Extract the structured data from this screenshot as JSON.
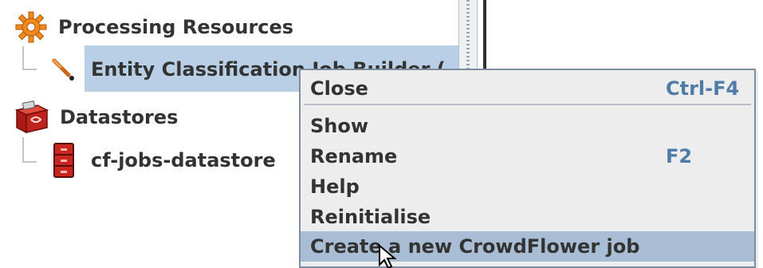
{
  "tree": {
    "processing_resources": {
      "label": "Processing Resources",
      "icon": "gear-icon"
    },
    "entity_classification": {
      "label": "Entity Classification Job Builder (",
      "icon": "wrench-icon"
    },
    "datastores": {
      "label": "Datastores",
      "icon": "datastore-box-icon"
    },
    "cf_jobs_datastore": {
      "label": "cf-jobs-datastore",
      "icon": "file-cabinet-icon"
    }
  },
  "context_menu": {
    "close": {
      "label": "Close",
      "accelerator": "Ctrl-F4"
    },
    "show": {
      "label": "Show"
    },
    "rename": {
      "label": "Rename",
      "accelerator": "F2"
    },
    "help": {
      "label": "Help"
    },
    "reinitialise": {
      "label": "Reinitialise"
    },
    "create_job": {
      "label": "Create a new CrowdFlower job"
    }
  },
  "colors": {
    "selection": "#b8cfe5",
    "menu_background": "#ededed",
    "menu_highlight": "#a9bed4",
    "accelerator": "#4f7ba6",
    "gear_orange": "#f08a1a",
    "datastore_red": "#c0231d"
  }
}
